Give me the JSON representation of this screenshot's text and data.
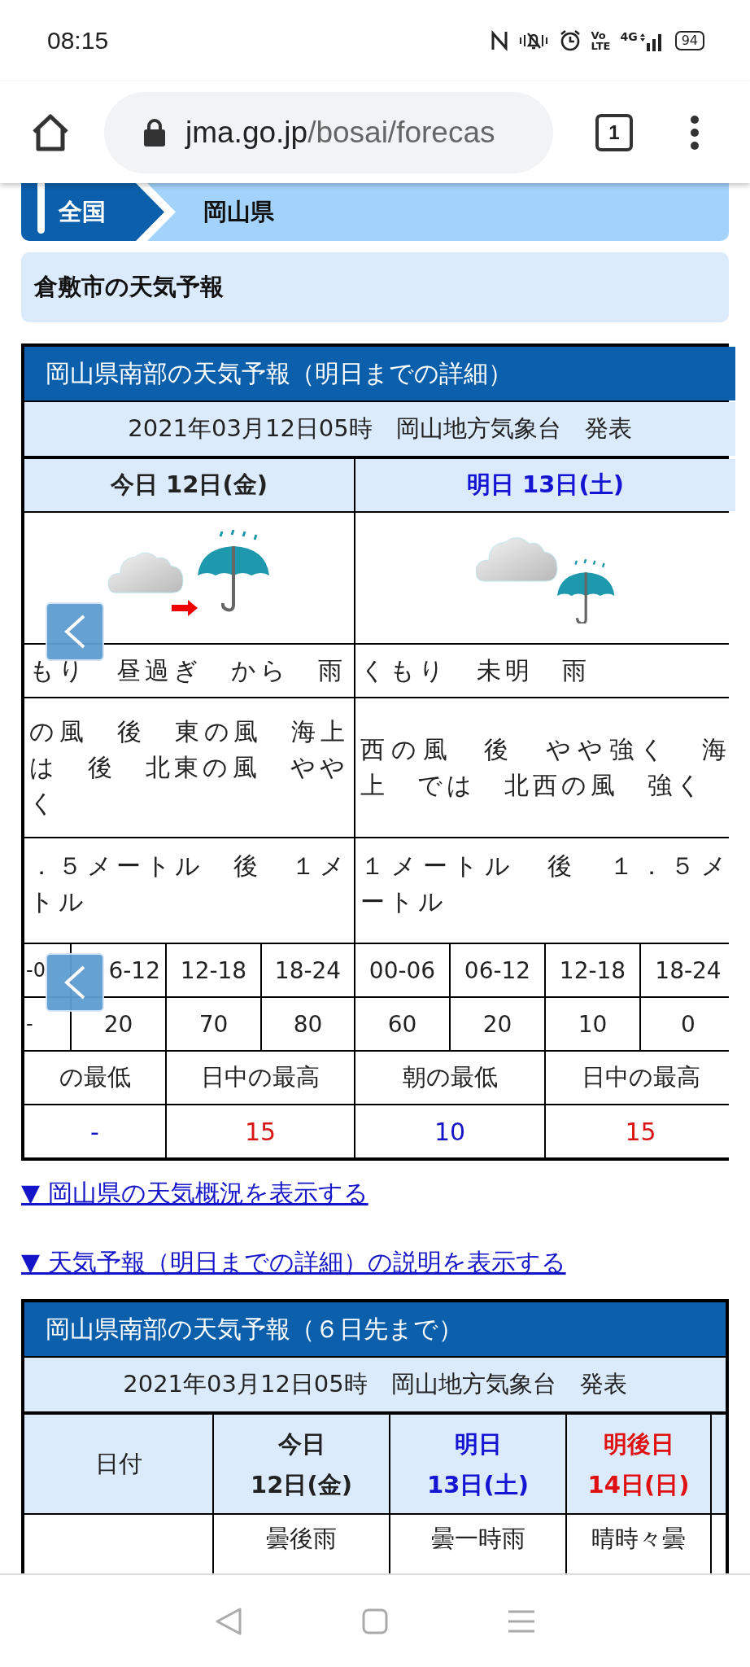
{
  "status_bar": {
    "time": "08:15",
    "volte": [
      "Vo",
      "LTE"
    ],
    "network": "4G",
    "battery": "94"
  },
  "browser": {
    "url_host": "jma.go.jp",
    "url_path": "/bosai/forecas",
    "tab_count": "1"
  },
  "breadcrumb": [
    {
      "label": "全国",
      "kind": "link"
    },
    {
      "label": "岡山県",
      "kind": "current"
    }
  ],
  "page_title": "倉敷市の天気予報",
  "detail_forecast": {
    "title": "岡山県南部の天気予報（明日までの詳細）",
    "issued": "2021年03月12日05時　岡山地方気象台　発表",
    "days": [
      {
        "label": "今日 12日(金)",
        "kind": "today",
        "weather": "もり　昼過ぎ　から　雨",
        "wind": [
          "の風　後　東の風　海上",
          "は　後　北東の風　やや",
          "く"
        ],
        "wave": [
          "．５メートル　後　１メ",
          "トル"
        ]
      },
      {
        "label": "明日 13日(土)",
        "kind": "tomorrow",
        "weather": "くもり　未明　雨",
        "wind": [
          "西の風　後　やや強く　海",
          "上　では　北西の風　強く"
        ],
        "wave": [
          "１メートル　後　１．５メ",
          "ートル"
        ]
      }
    ],
    "pop": [
      {
        "time": "-0",
        "value": "-"
      },
      {
        "time": "6-12",
        "value": "20"
      },
      {
        "time": "12-18",
        "value": "70"
      },
      {
        "time": "18-24",
        "value": "80"
      },
      {
        "time": "00-06",
        "value": "60"
      },
      {
        "time": "06-12",
        "value": "20"
      },
      {
        "time": "12-18",
        "value": "10"
      },
      {
        "time": "18-24",
        "value": "0"
      }
    ],
    "temps": [
      {
        "label": "の最低",
        "value": "-",
        "kind": "min"
      },
      {
        "label": "日中の最高",
        "value": "15",
        "kind": "max"
      },
      {
        "label": "朝の最低",
        "value": "10",
        "kind": "min"
      },
      {
        "label": "日中の最高",
        "value": "15",
        "kind": "max"
      }
    ]
  },
  "links": [
    "▼ 岡山県の天気概況を表示する",
    "▼ 天気予報（明日までの詳細）の説明を表示する"
  ],
  "weekly_forecast": {
    "title": "岡山県南部の天気予報（６日先まで）",
    "issued": "2021年03月12日05時　岡山地方気象台　発表",
    "date_header": "日付",
    "days": [
      {
        "day": "今日",
        "date": "12日(金)",
        "kind": "today",
        "weather": "曇後雨"
      },
      {
        "day": "明日",
        "date": "13日(土)",
        "kind": "tomorrow",
        "weather": "曇一時雨"
      },
      {
        "day": "明後日",
        "date": "14日(日)",
        "kind": "holiday",
        "weather": "晴時々曇"
      }
    ]
  }
}
